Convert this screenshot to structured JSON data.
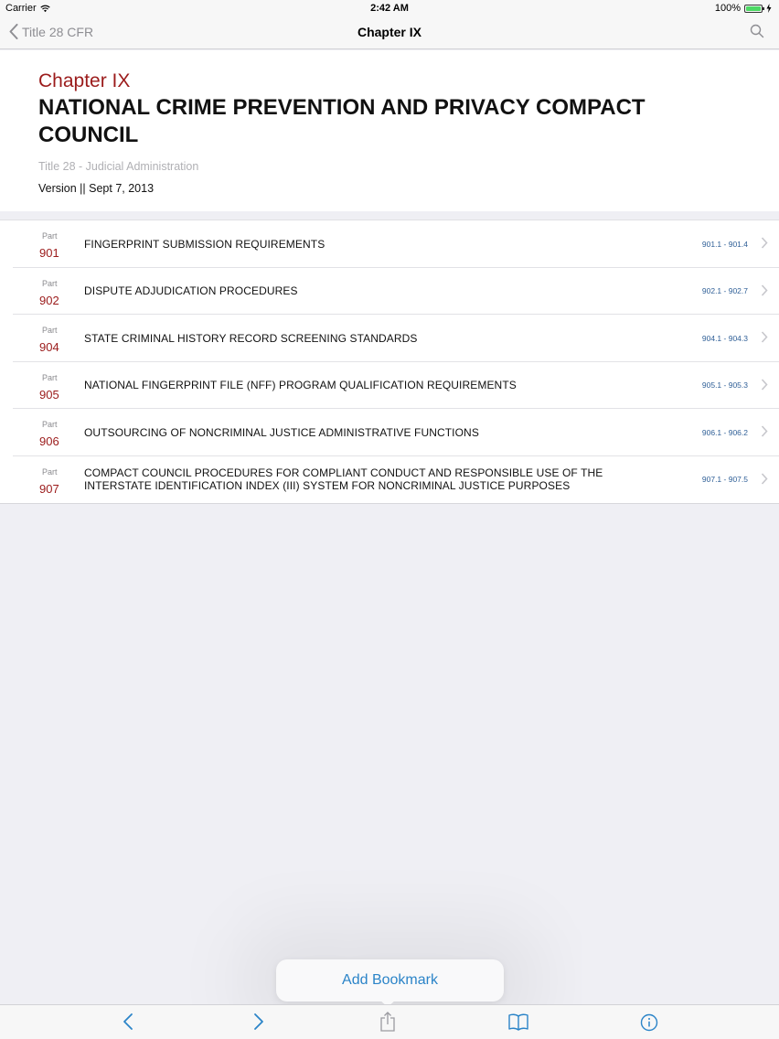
{
  "status_bar": {
    "carrier": "Carrier",
    "time": "2:42 AM",
    "battery": "100%"
  },
  "nav": {
    "back_label": "Title 28 CFR",
    "title": "Chapter IX"
  },
  "header": {
    "chapter": "Chapter IX",
    "title": "NATIONAL CRIME PREVENTION AND PRIVACY COMPACT COUNCIL",
    "subtitle": "Title 28 - Judicial Administration",
    "version": "Version || Sept 7, 2013"
  },
  "parts": [
    {
      "label": "Part",
      "number": "901",
      "name": "FINGERPRINT SUBMISSION REQUIREMENTS",
      "range": "901.1 - 901.4"
    },
    {
      "label": "Part",
      "number": "902",
      "name": "DISPUTE ADJUDICATION PROCEDURES",
      "range": "902.1 - 902.7"
    },
    {
      "label": "Part",
      "number": "904",
      "name": "STATE CRIMINAL HISTORY RECORD SCREENING STANDARDS",
      "range": "904.1 - 904.3"
    },
    {
      "label": "Part",
      "number": "905",
      "name": "NATIONAL FINGERPRINT FILE (NFF) PROGRAM QUALIFICATION REQUIREMENTS",
      "range": "905.1 - 905.3"
    },
    {
      "label": "Part",
      "number": "906",
      "name": "OUTSOURCING OF NONCRIMINAL JUSTICE ADMINISTRATIVE FUNCTIONS",
      "range": "906.1 - 906.2"
    },
    {
      "label": "Part",
      "number": "907",
      "name": "COMPACT COUNCIL PROCEDURES FOR COMPLIANT CONDUCT AND RESPONSIBLE USE OF THE INTERSTATE IDENTIFICATION INDEX (III) SYSTEM FOR NONCRIMINAL JUSTICE PURPOSES",
      "range": "907.1 - 907.5"
    }
  ],
  "popover": {
    "label": "Add Bookmark"
  },
  "toolbar": {
    "icons": [
      "back-arrow-icon",
      "forward-arrow-icon",
      "share-icon",
      "book-icon",
      "info-icon"
    ]
  },
  "colors": {
    "accent_red": "#9b1b1b",
    "link_blue": "#2b84c8",
    "range_blue": "#2f5f97"
  }
}
